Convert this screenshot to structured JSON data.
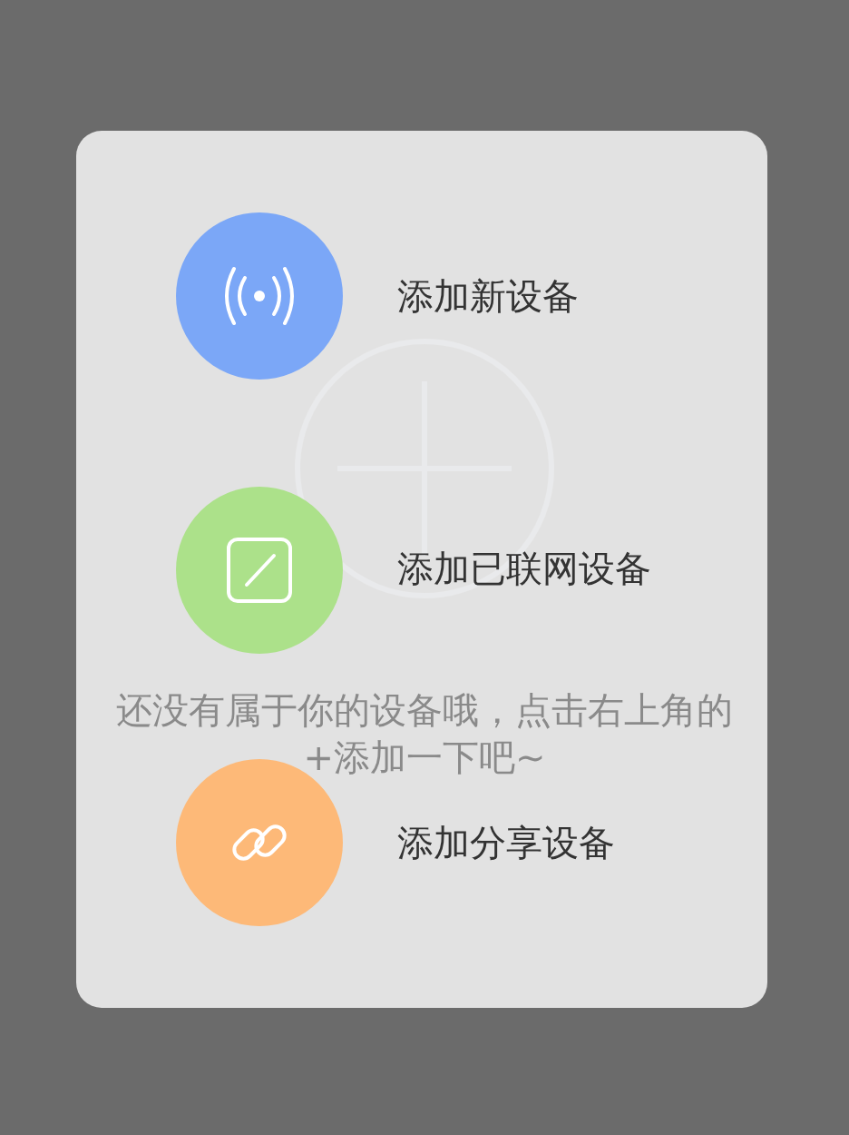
{
  "background": {
    "message": "还没有属于你的设备哦，点击右上角的+添加一下吧~"
  },
  "menu": {
    "items": [
      {
        "kind": "signal",
        "label": "添加新设备",
        "color": "#7ba7f7"
      },
      {
        "kind": "edit",
        "label": "添加已联网设备",
        "color": "#ace18a"
      },
      {
        "kind": "link",
        "label": "添加分享设备",
        "color": "#fdb978"
      }
    ]
  }
}
